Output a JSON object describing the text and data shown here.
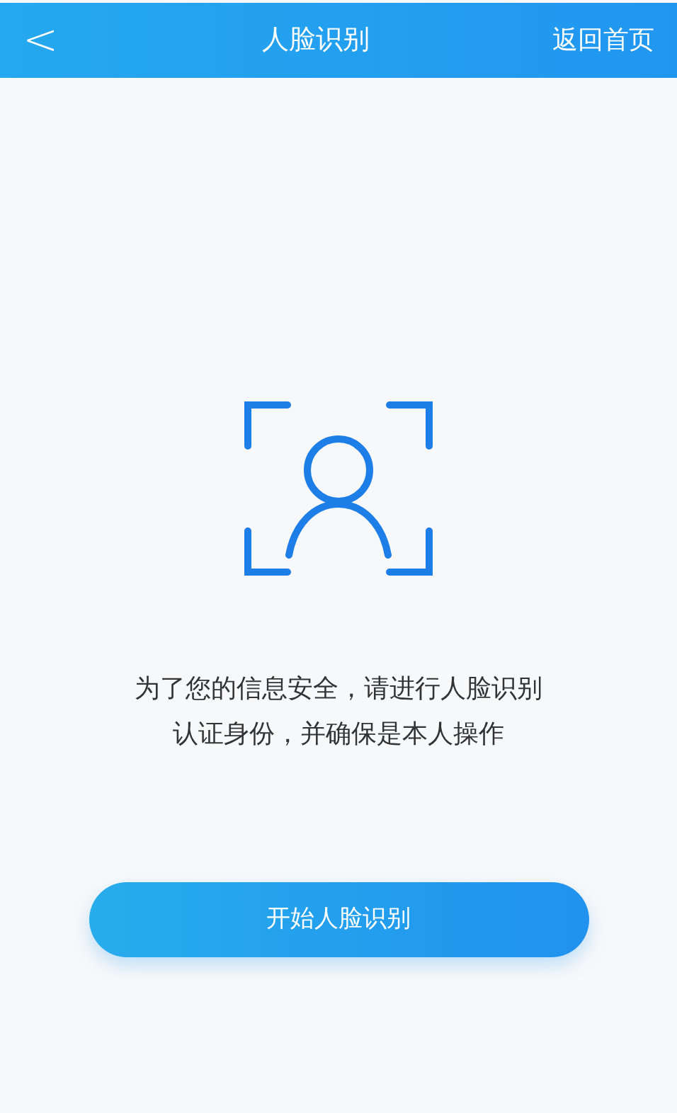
{
  "header": {
    "back_icon": "<",
    "title": "人脸识别",
    "home_link": "返回首页"
  },
  "message_lines": [
    "为了您的信息安全，请进行人脸识别",
    "认证身份，并确保是本人操作"
  ],
  "start_button": {
    "label": "开始人脸识别"
  }
}
